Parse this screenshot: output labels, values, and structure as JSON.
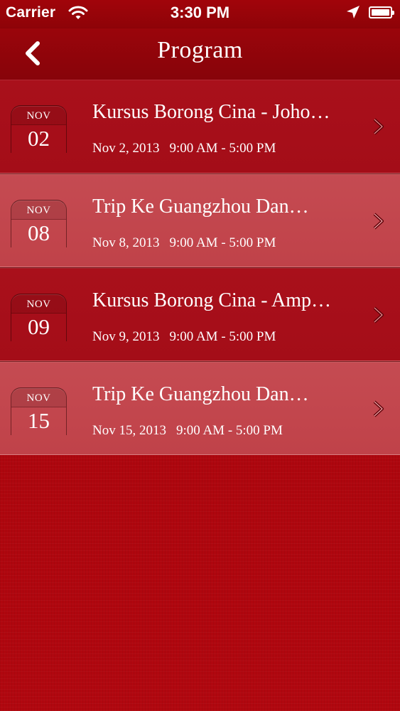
{
  "status_bar": {
    "carrier": "Carrier",
    "time": "3:30 PM",
    "icons": [
      "wifi-icon",
      "location-icon",
      "battery-icon"
    ]
  },
  "nav": {
    "title": "Program",
    "back_icon": "chevron-left-icon"
  },
  "events": [
    {
      "month": "NOV",
      "day": "02",
      "title": "Kursus Borong Cina - Joho…",
      "date": "Nov 2, 2013",
      "time": "9:00 AM - 5:00 PM"
    },
    {
      "month": "NOV",
      "day": "08",
      "title": "Trip Ke Guangzhou Dan…",
      "date": "Nov 8, 2013",
      "time": "9:00 AM - 5:00 PM"
    },
    {
      "month": "NOV",
      "day": "09",
      "title": "Kursus Borong Cina - Amp…",
      "date": "Nov 9, 2013",
      "time": "9:00 AM - 5:00 PM"
    },
    {
      "month": "NOV",
      "day": "15",
      "title": "Trip Ke Guangzhou Dan…",
      "date": "Nov 15, 2013",
      "time": "9:00 AM - 5:00 PM"
    }
  ],
  "colors": {
    "background": "#b3070f",
    "nav_bar": "#8e0308",
    "row_dark": "#a70f1a",
    "row_light": "#c3474e",
    "text": "#ffffff"
  }
}
